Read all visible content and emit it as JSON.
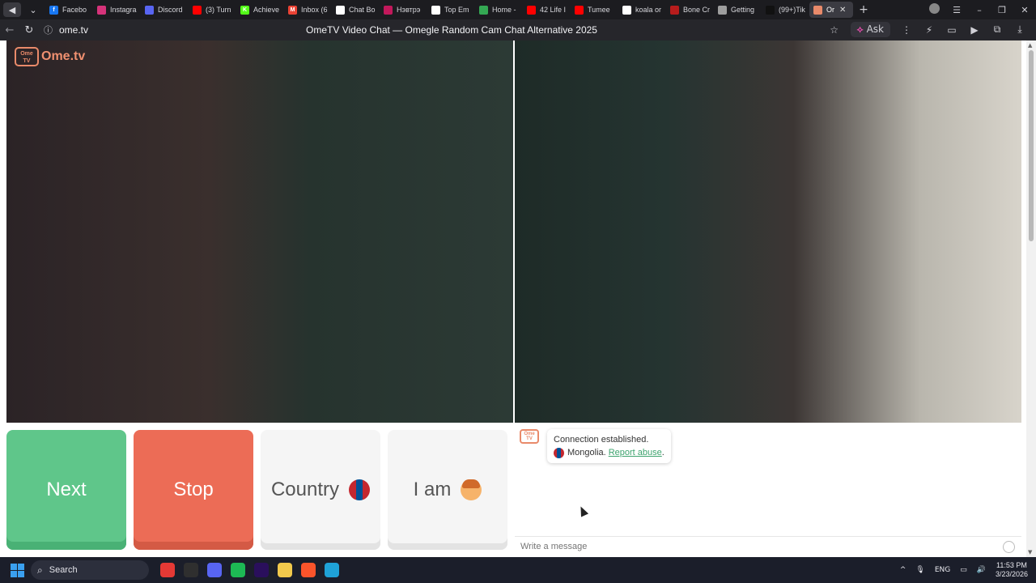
{
  "browser": {
    "tabs": [
      {
        "label": "Facebo",
        "icon": "facebook-icon",
        "color": "#1877f2",
        "glyph": "f"
      },
      {
        "label": "Instagra",
        "icon": "instagram-icon",
        "color": "#d6337a",
        "glyph": ""
      },
      {
        "label": "Discord",
        "icon": "discord-icon",
        "color": "#5865f2",
        "glyph": ""
      },
      {
        "label": "(3) Turn",
        "icon": "youtube-icon",
        "color": "#ff0000",
        "glyph": ""
      },
      {
        "label": "Achieve",
        "icon": "kick-icon",
        "color": "#53fc18",
        "glyph": "K"
      },
      {
        "label": "Inbox (6",
        "icon": "gmail-icon",
        "color": "#ea4335",
        "glyph": "M"
      },
      {
        "label": "Chat Bo",
        "icon": "chat-icon",
        "color": "#ffffff",
        "glyph": ""
      },
      {
        "label": "Нэвтрэ",
        "icon": "page-icon",
        "color": "#c2185b",
        "glyph": ""
      },
      {
        "label": "Top Em",
        "icon": "page-icon",
        "color": "#ffffff",
        "glyph": ""
      },
      {
        "label": "Home -",
        "icon": "drive-icon",
        "color": "#34a853",
        "glyph": ""
      },
      {
        "label": "42 Life I",
        "icon": "youtube-icon",
        "color": "#ff0000",
        "glyph": ""
      },
      {
        "label": "Tumee",
        "icon": "youtube-icon",
        "color": "#ff0000",
        "glyph": ""
      },
      {
        "label": "koala or",
        "icon": "google-icon",
        "color": "#ffffff",
        "glyph": "G"
      },
      {
        "label": "Bone Cr",
        "icon": "page-icon",
        "color": "#b71c1c",
        "glyph": ""
      },
      {
        "label": "Getting",
        "icon": "page-icon",
        "color": "#9e9e9e",
        "glyph": ""
      },
      {
        "label": "(99+)Tik",
        "icon": "tiktok-icon",
        "color": "#111111",
        "glyph": ""
      },
      {
        "label": "Or",
        "icon": "ometv-icon",
        "color": "#e98a6a",
        "glyph": "",
        "active": true
      }
    ],
    "url": "ome.tv",
    "title": "OmeTV Video Chat — Omegle Random Cam Chat Alternative 2025",
    "ask_label": "Ask"
  },
  "logo": {
    "badge": "Ome TV",
    "text": "Ome.tv"
  },
  "controls": {
    "next_label": "Next",
    "stop_label": "Stop",
    "country_label": "Country",
    "iam_label": "I am"
  },
  "chat": {
    "logo_badge": "Ome TV",
    "system_line1": "Connection established.",
    "country": "Mongolia.",
    "report_label": "Report abuse",
    "report_suffix": ".",
    "placeholder": "Write a message"
  },
  "taskbar": {
    "search_label": "Search",
    "language": "ENG",
    "time": "11:53 PM",
    "date": "3/23/2026",
    "apps": [
      {
        "name": "yandex-icon",
        "color": "#e53935"
      },
      {
        "name": "chatgpt-icon",
        "color": "#2f2f2f"
      },
      {
        "name": "discord-icon",
        "color": "#5865f2"
      },
      {
        "name": "spotify-icon",
        "color": "#1db954"
      },
      {
        "name": "premiere-icon",
        "color": "#2a0f5c"
      },
      {
        "name": "file-explorer-icon",
        "color": "#f2c94c"
      },
      {
        "name": "brave-icon",
        "color": "#fb542b"
      },
      {
        "name": "edge-icon",
        "color": "#1fa2d8"
      }
    ]
  },
  "colors": {
    "next": "#5fc68a",
    "stop": "#ec6c56",
    "flag_mongolia": [
      "#c4272f",
      "#015197",
      "#c4272f"
    ]
  }
}
